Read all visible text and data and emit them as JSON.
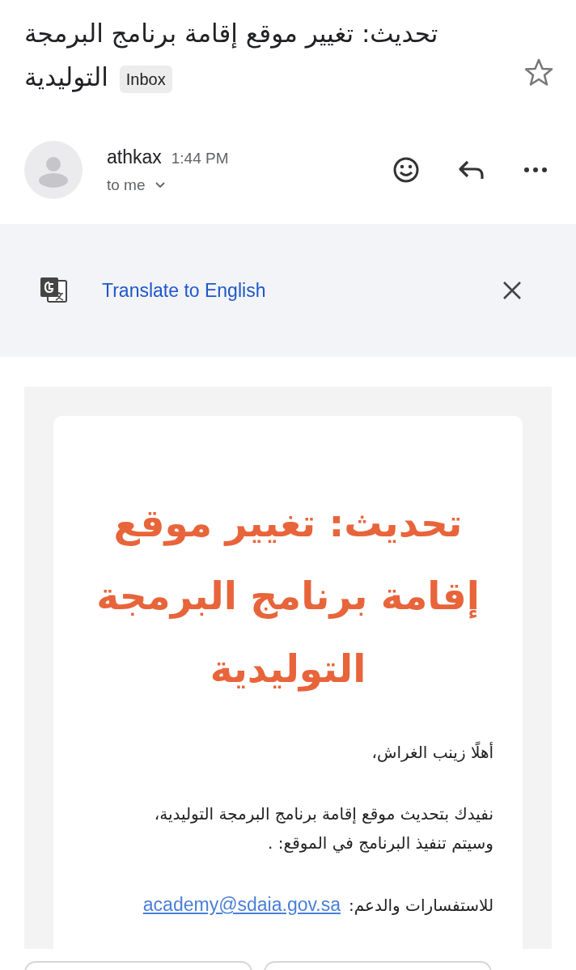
{
  "subject": {
    "title": "تحديث: تغيير موقع إقامة برنامج البرمجة التوليدية",
    "label": "Inbox",
    "starred": false
  },
  "sender": {
    "name": "athkax",
    "time": "1:44 PM",
    "recipient": "to me"
  },
  "translate_bar": {
    "link": "Translate to English"
  },
  "message": {
    "heading": "تحديث: تغيير موقع إقامة برنامج البرمجة التوليدية",
    "greeting": "أهلًا زينب الغراش،",
    "paragraph": "نفيدك بتحديث موقع إقامة برنامج البرمجة التوليدية،\nوسيتم تنفيذ البرنامج في الموقع: .",
    "support_label": "للاستفسارات والدعم:",
    "support_email": "academy@sdaia.gov.sa"
  }
}
